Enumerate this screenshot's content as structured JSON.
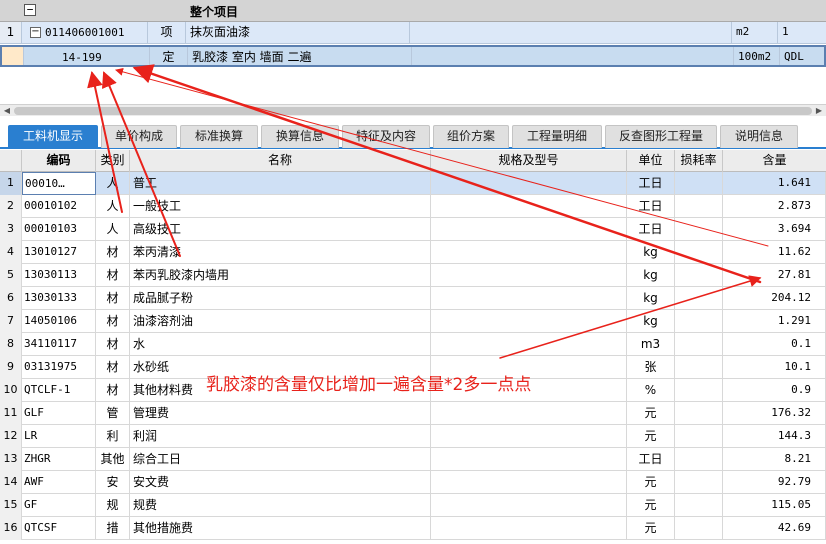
{
  "top_grid": {
    "collapse_glyph": "−",
    "title": "整个项目",
    "rows": [
      {
        "rownum": "1",
        "toggle": "−",
        "code": "011406001001",
        "kind": "项",
        "name": "抹灰面油漆",
        "unit": "m2",
        "qty": "1"
      },
      {
        "rownum": "",
        "toggle": "",
        "code": "14-199",
        "kind": "定",
        "name": "乳胶漆 室内 墙面 二遍",
        "unit": "100m2",
        "qty": "QDL"
      }
    ]
  },
  "scrollbar": {
    "left_arrow": "◀",
    "right_arrow": "▶"
  },
  "tabs": [
    {
      "label": "工料机显示",
      "active": true
    },
    {
      "label": "单价构成"
    },
    {
      "label": "标准换算"
    },
    {
      "label": "换算信息"
    },
    {
      "label": "特征及内容"
    },
    {
      "label": "组价方案"
    },
    {
      "label": "工程量明细"
    },
    {
      "label": "反查图形工程量"
    },
    {
      "label": "说明信息"
    }
  ],
  "grid": {
    "headers": {
      "code": "编码",
      "type": "类别",
      "name": "名称",
      "spec": "规格及型号",
      "unit": "单位",
      "loss": "损耗率",
      "qty": "含量"
    },
    "rows": [
      {
        "n": "1",
        "code": "00010…",
        "type": "人",
        "name": "普工",
        "unit": "工日",
        "qty": "1.641"
      },
      {
        "n": "2",
        "code": "00010102",
        "type": "人",
        "name": "一般技工",
        "unit": "工日",
        "qty": "2.873"
      },
      {
        "n": "3",
        "code": "00010103",
        "type": "人",
        "name": "高级技工",
        "unit": "工日",
        "qty": "3.694"
      },
      {
        "n": "4",
        "code": "13010127",
        "type": "材",
        "name": "苯丙清漆",
        "unit": "kg",
        "qty": "11.62"
      },
      {
        "n": "5",
        "code": "13030113",
        "type": "材",
        "name": "苯丙乳胶漆内墙用",
        "unit": "kg",
        "qty": "27.81"
      },
      {
        "n": "6",
        "code": "13030133",
        "type": "材",
        "name": "成品腻子粉",
        "unit": "kg",
        "qty": "204.12"
      },
      {
        "n": "7",
        "code": "14050106",
        "type": "材",
        "name": "油漆溶剂油",
        "unit": "kg",
        "qty": "1.291"
      },
      {
        "n": "8",
        "code": "34110117",
        "type": "材",
        "name": "水",
        "unit": "m3",
        "qty": "0.1"
      },
      {
        "n": "9",
        "code": "03131975",
        "type": "材",
        "name": "水砂纸",
        "unit": "张",
        "qty": "10.1"
      },
      {
        "n": "10",
        "code": "QTCLF-1",
        "type": "材",
        "name": "其他材料费",
        "unit": "%",
        "qty": "0.9"
      },
      {
        "n": "11",
        "code": "GLF",
        "type": "管",
        "name": "管理费",
        "unit": "元",
        "qty": "176.32"
      },
      {
        "n": "12",
        "code": "LR",
        "type": "利",
        "name": "利润",
        "unit": "元",
        "qty": "144.3"
      },
      {
        "n": "13",
        "code": "ZHGR",
        "type": "其他",
        "name": "综合工日",
        "unit": "工日",
        "qty": "8.21"
      },
      {
        "n": "14",
        "code": "AWF",
        "type": "安",
        "name": "安文费",
        "unit": "元",
        "qty": "92.79"
      },
      {
        "n": "15",
        "code": "GF",
        "type": "规",
        "name": "规费",
        "unit": "元",
        "qty": "115.05"
      },
      {
        "n": "16",
        "code": "QTCSF",
        "type": "措",
        "name": "其他措施费",
        "unit": "元",
        "qty": "42.69"
      }
    ]
  },
  "annotation": {
    "text": "乳胶漆的含量仅比增加一遍含量*2多一点点",
    "color": "#e8221b"
  }
}
